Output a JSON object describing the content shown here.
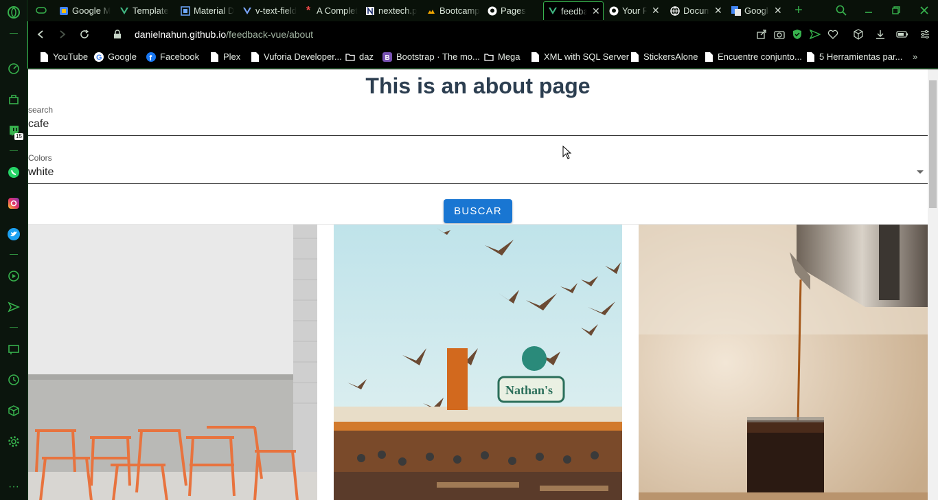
{
  "browser": {
    "tabs": [
      {
        "title": "Google M",
        "favicon": "google-drive-icon"
      },
      {
        "title": "Template",
        "favicon": "vue-icon"
      },
      {
        "title": "Material D",
        "favicon": "material-icon"
      },
      {
        "title": "v-text-field",
        "favicon": "vue-icon"
      },
      {
        "title": "A Complet",
        "favicon": "asterisk-icon"
      },
      {
        "title": "nextech.p",
        "favicon": "nextech-icon"
      },
      {
        "title": "Bootcamp",
        "favicon": "bootcamp-icon"
      },
      {
        "title": "Pages",
        "favicon": "github-icon"
      },
      {
        "title": "feedba",
        "favicon": "vue-icon"
      },
      {
        "title": "Your R",
        "favicon": "github-icon"
      },
      {
        "title": "Docum",
        "favicon": "globe-icon"
      },
      {
        "title": "Google",
        "favicon": "google-translate-icon"
      }
    ],
    "url_host": "danielnahun.github.io",
    "url_path": "/feedback-vue/about",
    "bookmarks": [
      {
        "label": "YouTube",
        "icon": "page-icon"
      },
      {
        "label": "Google",
        "icon": "google-icon"
      },
      {
        "label": "Facebook",
        "icon": "facebook-icon"
      },
      {
        "label": "Plex",
        "icon": "page-icon"
      },
      {
        "label": "Vuforia Developer...",
        "icon": "page-icon"
      },
      {
        "label": "daz",
        "icon": "folder-icon"
      },
      {
        "label": "Bootstrap · The mo...",
        "icon": "bootstrap-icon"
      },
      {
        "label": "Mega",
        "icon": "folder-icon"
      },
      {
        "label": "XML with SQL Server",
        "icon": "page-icon"
      },
      {
        "label": "StickersAlone",
        "icon": "page-icon"
      },
      {
        "label": "Encuentre conjunto...",
        "icon": "page-icon"
      },
      {
        "label": "5 Herramientas par...",
        "icon": "page-icon"
      }
    ],
    "sidebar_badge": "15"
  },
  "page": {
    "title": "This is an about page",
    "search": {
      "label": "search",
      "value": "cafe"
    },
    "colors": {
      "label": "Colors",
      "value": "white"
    },
    "button": "BUSCAR"
  },
  "colors": {
    "accent": "#37b24d",
    "button": "#1976d2",
    "heading": "#2c3e50"
  }
}
